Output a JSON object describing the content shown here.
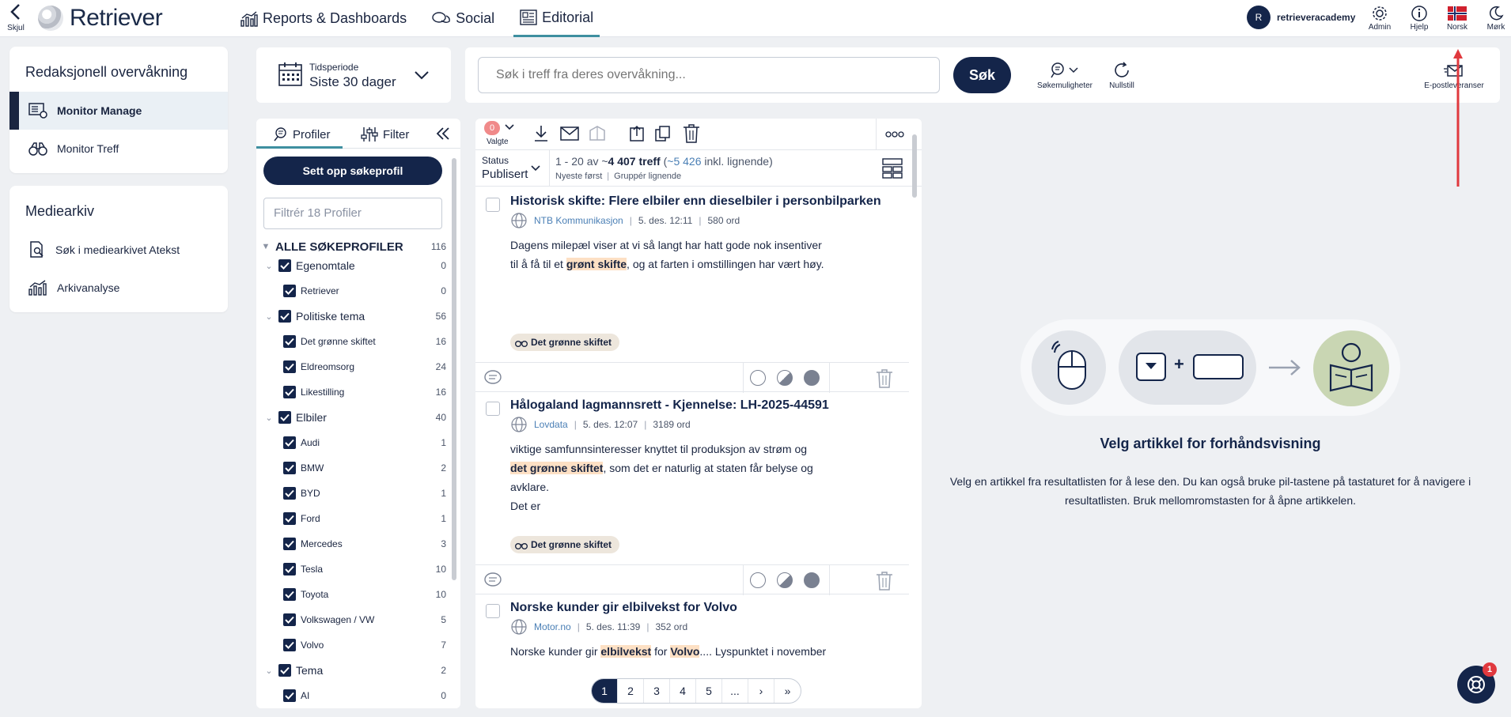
{
  "topbar": {
    "hide_label": "Skjul",
    "logo_text": "Retriever",
    "nav": [
      {
        "label": "Reports & Dashboards"
      },
      {
        "label": "Social"
      },
      {
        "label": "Editorial"
      }
    ],
    "user": {
      "initial": "R",
      "name": "retrieveracademy"
    },
    "tools": {
      "admin": "Admin",
      "help": "Hjelp",
      "language": "Norsk",
      "dark": "Mørk"
    }
  },
  "sidebar": {
    "section1_title": "Redaksjonell overvåkning",
    "section1_items": [
      {
        "label": "Monitor Manage"
      },
      {
        "label": "Monitor Treff"
      }
    ],
    "section2_title": "Mediearkiv",
    "section2_items": [
      {
        "label": "Søk i mediearkivet Atekst"
      },
      {
        "label": "Arkivanalyse"
      }
    ]
  },
  "period": {
    "label": "Tidsperiode",
    "value": "Siste 30 dager"
  },
  "search": {
    "placeholder": "Søk i treff fra deres overvåkning...",
    "button": "Søk",
    "options": "Søkemuligheter",
    "reset": "Nullstill",
    "email": "E-postleveranser"
  },
  "profiles": {
    "tab_profiles": "Profiler",
    "tab_filter": "Filter",
    "setup_button": "Sett opp søkeprofil",
    "filter_placeholder": "Filtrér 18 Profiler",
    "root": {
      "label": "ALLE SØKEPROFILER",
      "count": "116"
    },
    "tree": [
      {
        "label": "Egenomtale",
        "count": "0",
        "group": true
      },
      {
        "label": "Retriever",
        "count": "0"
      },
      {
        "label": "Politiske tema",
        "count": "56",
        "group": true
      },
      {
        "label": "Det grønne skiftet",
        "count": "16"
      },
      {
        "label": "Eldreomsorg",
        "count": "24"
      },
      {
        "label": "Likestilling",
        "count": "16"
      },
      {
        "label": "Elbiler",
        "count": "40",
        "group": true
      },
      {
        "label": "Audi",
        "count": "1"
      },
      {
        "label": "BMW",
        "count": "2"
      },
      {
        "label": "BYD",
        "count": "1"
      },
      {
        "label": "Ford",
        "count": "1"
      },
      {
        "label": "Mercedes",
        "count": "3"
      },
      {
        "label": "Tesla",
        "count": "10"
      },
      {
        "label": "Toyota",
        "count": "10"
      },
      {
        "label": "Volkswagen / VW",
        "count": "5"
      },
      {
        "label": "Volvo",
        "count": "7"
      },
      {
        "label": "Tema",
        "count": "2",
        "group": true
      },
      {
        "label": "AI",
        "count": "0"
      }
    ]
  },
  "results": {
    "selected_count": "0",
    "selected_label": "Valgte",
    "status_label": "Status",
    "status_value": "Publisert",
    "range": "1 - 20 av ~",
    "total": "4 407 treff",
    "similar_open": "(",
    "similar": "~5 426",
    "similar_close": " inkl. lignende)",
    "sort": "Nyeste først",
    "group": "Gruppér lignende",
    "articles": [
      {
        "title": "Historisk skifte: Flere elbiler enn dieselbiler i personbilparken",
        "source": "NTB Kommunikasjon",
        "date": "5. des. 12:11",
        "words": "580 ord",
        "tag": "Det grønne skiftet",
        "t1": "Dagens milepæl viser at vi så langt har hatt gode nok insentiver",
        "t2a": "til å få til et ",
        "t2b": "grønt skifte",
        "t2c": ", og at farten i omstillingen har vært høy."
      },
      {
        "title": "Hålogaland lagmannsrett - Kjennelse: LH-2025-44591",
        "source": "Lovdata",
        "date": "5. des. 12:07",
        "words": "3189 ord",
        "tag": "Det grønne skiftet",
        "t1": "viktige samfunnsinteresser knyttet til produksjon av strøm og",
        "t2a": "",
        "t2b": "det grønne skiftet",
        "t2c": ", som det er naturlig at staten får belyse og",
        "t3": "avklare.",
        "t4": "Det er"
      },
      {
        "title": "Norske kunder gir elbilvekst for Volvo",
        "source": "Motor.no",
        "date": "5. des. 11:39",
        "words": "352 ord",
        "t1a": "Norske kunder gir ",
        "t1b": "elbilvekst",
        "t1c": " for ",
        "t1d": "Volvo",
        "t1e": ".... Lyspunktet i november"
      }
    ],
    "pages": [
      "1",
      "2",
      "3",
      "4",
      "5",
      "...",
      "›",
      "»"
    ]
  },
  "preview": {
    "title": "Velg artikkel for forhåndsvisning",
    "line1": "Velg en artikkel fra resultatlisten for å lese den. Du kan også bruke pil-tastene på tastaturet for å navigere i",
    "line2": "resultatlisten. Bruk mellomromstasten for å åpne artikkelen."
  },
  "help_badge": "1",
  "colors": {
    "navy": "#14254a",
    "accent": "#3e8fa0",
    "highlight": "#fde0c4",
    "arrow": "#e0393e"
  }
}
